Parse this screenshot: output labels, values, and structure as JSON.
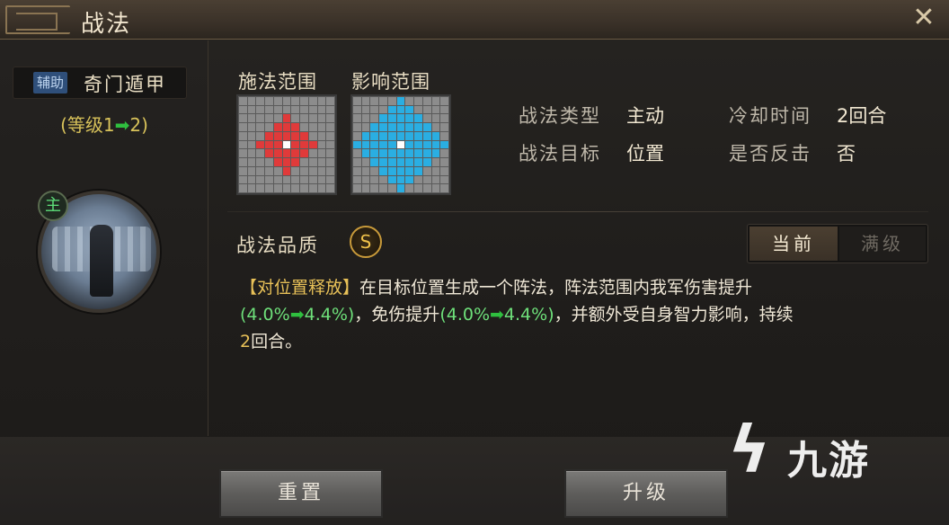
{
  "window": {
    "title": "战法",
    "close_icon": "close-icon"
  },
  "tactic": {
    "tag": "辅助",
    "name": "奇门遁甲",
    "level_prefix": "(等级1",
    "level_suffix": "2)",
    "commander_badge": "主"
  },
  "ranges": {
    "cast_label": "施法范围",
    "effect_label": "影响范围",
    "colors": {
      "cast": "#e03a3a",
      "effect": "#2aaee2",
      "center": "#ffffff",
      "empty": "#8c8c8c"
    }
  },
  "info": {
    "type_label": "战法类型",
    "type_value": "主动",
    "target_label": "战法目标",
    "target_value": "位置",
    "cooldown_label": "冷却时间",
    "cooldown_value": "2回合",
    "counter_label": "是否反击",
    "counter_value": "否"
  },
  "quality": {
    "label": "战法品质",
    "badge": "S"
  },
  "toggle": {
    "current": "当前",
    "max": "满级"
  },
  "description": {
    "keyword": "【对位置释放】",
    "text1": "在目标位置生成一个阵法，阵法范围内我军伤害提升",
    "v1a": "(4.0%",
    "v1b": "4.4%)",
    "text2": "，免伤提升",
    "v2a": "(4.0%",
    "v2b": "4.4%)",
    "text3": "，并额外受自身智力影响，持续",
    "v3": "2",
    "text4": "回合。"
  },
  "buttons": {
    "reset": "重置",
    "upgrade": "升级"
  },
  "watermark": {
    "text": "九游"
  }
}
